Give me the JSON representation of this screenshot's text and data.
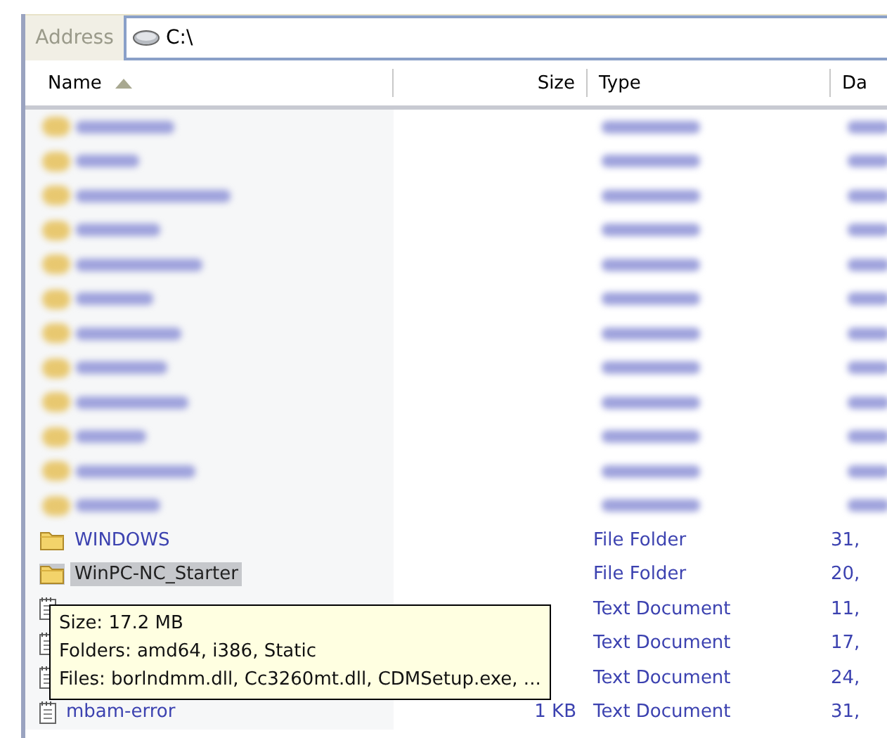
{
  "address_bar": {
    "label": "Address",
    "path": "C:\\"
  },
  "columns": [
    {
      "label": "Name",
      "sorted": true
    },
    {
      "label": "Size",
      "sorted": false
    },
    {
      "label": "Type",
      "sorted": false
    },
    {
      "label": "Da",
      "sorted": false
    }
  ],
  "rows": [
    {
      "kind": "blurred"
    },
    {
      "kind": "blurred"
    },
    {
      "kind": "blurred"
    },
    {
      "kind": "blurred"
    },
    {
      "kind": "blurred"
    },
    {
      "kind": "blurred"
    },
    {
      "kind": "blurred"
    },
    {
      "kind": "blurred"
    },
    {
      "kind": "blurred"
    },
    {
      "kind": "blurred"
    },
    {
      "kind": "blurred"
    },
    {
      "kind": "blurred"
    },
    {
      "kind": "folder",
      "name": "WINDOWS",
      "type": "File Folder",
      "date": "31,",
      "selected": false
    },
    {
      "kind": "folder",
      "name": "WinPC-NC_Starter",
      "type": "File Folder",
      "date": "20,",
      "selected": true
    },
    {
      "kind": "text",
      "type": "Text Document",
      "date": "11,",
      "selected": false
    },
    {
      "kind": "text",
      "type": "Text Document",
      "date": "17,",
      "selected": false
    },
    {
      "kind": "text",
      "type": "Text Document",
      "date": "24,",
      "selected": false
    },
    {
      "kind": "text",
      "name": "mbam-error",
      "size": "1 KB",
      "type": "Text Document",
      "date": "31,",
      "selected": false
    }
  ],
  "tooltip": {
    "lines": [
      "Size: 17.2 MB",
      "Folders: amd64, i386, Static",
      "Files: borlndmm.dll, Cc3260mt.dll, CDMSetup.exe, ..."
    ]
  }
}
